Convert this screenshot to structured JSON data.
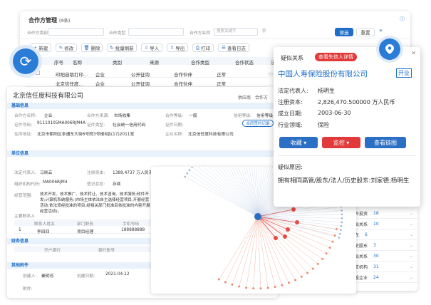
{
  "main": {
    "title": "合作方管理",
    "title_sub": "(9条)",
    "filters": {
      "type1_label": "合作方类别",
      "type2_label": "合作类型",
      "name_label": "合作方名称",
      "name_placeholder": "搜索关键字",
      "filter_btn": "筛选",
      "reset_btn": "重置",
      "expand_icon": "»"
    },
    "toolbar": [
      "新建",
      "修改",
      "删除",
      "批量刷新",
      "导入",
      "导出",
      "打印",
      "查看日志"
    ],
    "table_headers": [
      "序号",
      "名称",
      "类别",
      "来源",
      "合作类型",
      "合作状态",
      "法"
    ],
    "rows": [
      {
        "no": "1",
        "name": "印阳自助打印...",
        "cat": "企业",
        "src": "公开征询",
        "type": "合作伙伴",
        "status": "正常",
        "f": "初"
      },
      {
        "no": "2",
        "name": "北京信任度...",
        "cat": "企业",
        "src": "公开征询",
        "type": "合作伙伴",
        "status": "正常",
        "f": "北"
      }
    ]
  },
  "detail": {
    "company": "北京信任度科技有限公司",
    "tabs": [
      "供应商",
      "合作方",
      "详情"
    ],
    "sections": {
      "basic": "基础信息",
      "unit": "单位信息",
      "finance": "财务信息",
      "other": "其他附件"
    },
    "basic": {
      "name_l": "合作方名称:",
      "name_v": "企业",
      "src_l": "合作方来源:",
      "src_v": "市场收集",
      "level_l": "合作等级:",
      "level_v": "一般",
      "credit_l": "信用等级:",
      "credit_v": "信用等级",
      "code_l": "证件号码:",
      "code_v": "91110105MA006RJM4A",
      "idtype_l": "证件类型:",
      "idtype_v": "社会统一信用代码",
      "date_l": "证件日期:",
      "date_v": "",
      "addr_l": "住所地址:",
      "addr_v": "北京市朝阳区阜通东大街6号院3号楼8层(17)2011室",
      "regname_l": "企业名称:",
      "regname_v": "北京信任度科技有限公司",
      "view_btn": "合同签约记录"
    },
    "unit": {
      "legal_l": "法定代表人:",
      "legal_v": "马晓云",
      "capital_l": "注册资本:",
      "capital_v": "1389.4737 万人民币",
      "reg_l": "注册日期:",
      "reg_v": "2016-04-11",
      "regno_l": "组织机构代码:",
      "regno_v": "MA006RJM4",
      "status_l": "登记状态:",
      "status_v": "存续",
      "scope_l": "经营范围:",
      "scope_v": "技术开发、技术推广、技术转让、技术咨询、技术服务;软件开发;计算机系统服务;(市场主体依法自主选择经营项目,开展经营活动;依法须经批准的项目,经相关部门批准后依批准的内容开展经营活动)。",
      "contact_label": "主要联系人",
      "contact_headers": [
        "联系人姓名",
        "部门职务",
        "手机号码"
      ],
      "contact_row": {
        "no": "1",
        "name": "李四四",
        "dept": "项目经理",
        "phone": "188888888"
      }
    },
    "finance": {
      "bank_l": "开户银行",
      "acct_l": "银行账号"
    },
    "other": {
      "creator_l": "创建人:",
      "creator_v": "秦明芳",
      "created_l": "创建日期:",
      "created_v": "2021-04-12",
      "att_l": "附件:"
    }
  },
  "popup": {
    "tag": "疑似关系",
    "alert": "查看失信人详情",
    "company": "中国人寿保险股份有限公司",
    "status": "开业",
    "fields": [
      {
        "label": "法定代表人:",
        "value": "杨明生"
      },
      {
        "label": "注册资本:",
        "value": "2,826,470.500000 万人民币"
      },
      {
        "label": "成立日期:",
        "value": "2003-06-30"
      },
      {
        "label": "行业领域:",
        "value": "保险"
      }
    ],
    "buttons": {
      "collect": "收藏",
      "monitor": "监控",
      "graph": "查看链图"
    },
    "reason_title": "疑似原因:",
    "reason": "拥有相同高管/股东/法人/历史股东:刘家德;杨明生"
  },
  "side_list": [
    {
      "label": "对外投资",
      "count": "18"
    },
    {
      "label": "疑似关系",
      "count": "10"
    },
    {
      "label": "股东",
      "count": "6"
    },
    {
      "label": "历史股东",
      "count": "3"
    },
    {
      "label": "疑似关系",
      "count": "30"
    },
    {
      "label": "分支机构",
      "count": "31"
    },
    {
      "label": "控股企业",
      "count": "24"
    }
  ],
  "colors": {
    "accent": "#1e6ec8",
    "red": "#e23a3a",
    "sync": "#2b7cd6"
  }
}
